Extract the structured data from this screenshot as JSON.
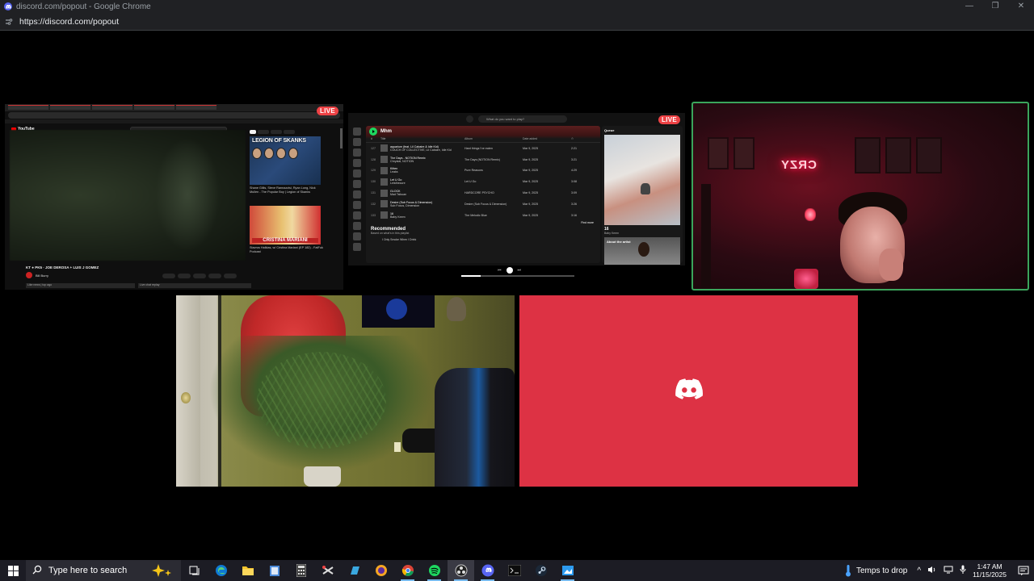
{
  "window": {
    "title": "discord.com/popout - Google Chrome",
    "url": "https://discord.com/popout",
    "controls": {
      "minimize": "—",
      "restore": "❐",
      "close": "✕"
    }
  },
  "streams": {
    "youtube": {
      "live_label": "LIVE",
      "brand": "YouTube",
      "video_title": "KT ● PK5 · JOE DEROSA + LUIS J GOMEZ",
      "channel": "Bill Burry",
      "comment_placeholder": "Like news | top ago",
      "live_chat": "Live chat replay",
      "side_thumb1_title": "LEGION OF SKANKS",
      "side_thumb1_caption": "Shane Gillis, Steve Rannazzisi, Ryan Long, Nick Mullen - The Popular Boy | Legion of Skanks",
      "side_thumb2_title": "CRISTINA MARIANI",
      "side_thumb2_caption": "Stavros Halkias, w/ Cristina Mariani (EP 182) - FatFuk Podcast"
    },
    "spotify": {
      "live_label": "LIVE",
      "search_placeholder": "What do you want to play?",
      "playlist_title": "Mhm",
      "columns": [
        "#",
        "Title",
        "Album",
        "Date added",
        "⏱"
      ],
      "tracks": [
        {
          "n": "127",
          "title": "aquarium (feat. Lil Cabaire & Idle Kid)",
          "artist": "COUCH OF COLLECTIVE, Lil Cabaire, Idle Kid",
          "album": "Hard things I've eaten",
          "date": "Mar 9, 2025",
          "dur": "2:21"
        },
        {
          "n": "128",
          "title": "The Days - NOTION Remix",
          "artist": "Chrystal, NOTION",
          "album": "The Days (NOTION Remix)",
          "date": "Mar 9, 2025",
          "dur": "3:21"
        },
        {
          "n": "129",
          "title": "Kitten",
          "artist": "Leaks",
          "album": "Pure Reasons",
          "date": "Mar 9, 2025",
          "dur": "4:29"
        },
        {
          "n": "130",
          "title": "Let U Go",
          "artist": "Leisthecure",
          "album": "Let U Go",
          "date": "Mar 9, 2025",
          "dur": "3:08"
        },
        {
          "n": "131",
          "title": "GLOCK",
          "artist": "Mad Tsikuan",
          "album": "HARDCORE PSYCHO",
          "date": "Mar 9, 2025",
          "dur": "3:09"
        },
        {
          "n": "132",
          "title": "Desire (Sub Focus & Dimension)",
          "artist": "Sub Focus, Dimension",
          "album": "Desire (Sub Focus & Dimension)",
          "date": "Mar 9, 2025",
          "dur": "3:26"
        },
        {
          "n": "133",
          "title": "16",
          "artist": "Baby Keem",
          "album": "The Melodic Blue",
          "date": "Mar 9, 2025",
          "dur": "3:16"
        }
      ],
      "find_more": "Find more",
      "recommended": "Recommended",
      "recommended_sub": "Based on what's in this playlist",
      "queue_label": "Queue",
      "now_playing_title": "16",
      "now_playing_artist": "Baby Keem",
      "about_artist": "About the artist",
      "next_track": "I Only Smoke When I Drink"
    },
    "webcam": {
      "neon_sign": "CRZY"
    },
    "discord": {
      "logo": "discord-logo"
    }
  },
  "taskbar": {
    "search_placeholder": "Type here to search",
    "weather": "Temps to drop",
    "time": "1:47 AM",
    "date": "11/15/2025"
  }
}
